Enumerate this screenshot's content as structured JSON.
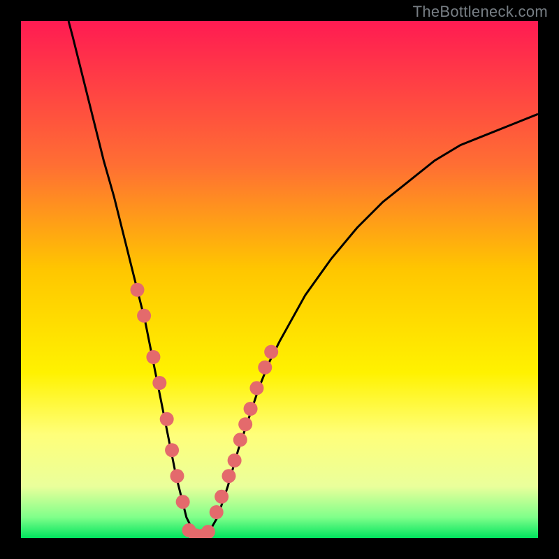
{
  "watermark": "TheBottleneck.com",
  "chart_data": {
    "type": "line",
    "title": "",
    "xlabel": "",
    "ylabel": "",
    "xlim": [
      0,
      100
    ],
    "ylim": [
      0,
      100
    ],
    "grid": false,
    "background_gradient": {
      "stops": [
        {
          "offset": 0,
          "color": "#ff1b52"
        },
        {
          "offset": 28,
          "color": "#ff6f33"
        },
        {
          "offset": 48,
          "color": "#ffc600"
        },
        {
          "offset": 68,
          "color": "#fff200"
        },
        {
          "offset": 80,
          "color": "#ffff7a"
        },
        {
          "offset": 90,
          "color": "#eaff9b"
        },
        {
          "offset": 96,
          "color": "#7fff8a"
        },
        {
          "offset": 100,
          "color": "#00e35e"
        }
      ]
    },
    "series": [
      {
        "name": "curve",
        "stroke": "#000000",
        "x": [
          9.2,
          10,
          12,
          14,
          16,
          18,
          20,
          22,
          24,
          25,
          26,
          27,
          28,
          29,
          30,
          31,
          32,
          33,
          34,
          35,
          36,
          38,
          40,
          42,
          44,
          46,
          48,
          50,
          55,
          60,
          65,
          70,
          75,
          80,
          85,
          90,
          95,
          100
        ],
        "y": [
          100,
          97,
          89,
          81,
          73,
          66,
          58,
          50,
          42,
          37,
          32,
          27,
          22,
          17,
          12,
          8,
          4,
          2,
          0.3,
          0,
          0.5,
          4,
          10,
          17,
          23,
          29,
          34,
          38,
          47,
          54,
          60,
          65,
          69,
          73,
          76,
          78,
          80,
          82
        ]
      },
      {
        "name": "scatter-left",
        "stroke": "none",
        "fill": "#e46a6c",
        "marker_r": 10,
        "x": [
          22.5,
          23.8,
          25.6,
          26.8,
          28.2,
          29.2,
          30.2,
          31.3
        ],
        "y": [
          48,
          43,
          35,
          30,
          23,
          17,
          12,
          7
        ]
      },
      {
        "name": "scatter-bottom",
        "stroke": "none",
        "fill": "#e46a6c",
        "marker_r": 10,
        "x": [
          32.5,
          33.8,
          35.0,
          36.2
        ],
        "y": [
          1.5,
          0.5,
          0.4,
          1.2
        ]
      },
      {
        "name": "scatter-right",
        "stroke": "none",
        "fill": "#e46a6c",
        "marker_r": 10,
        "x": [
          37.8,
          38.8,
          40.2,
          41.3,
          42.4,
          43.4,
          44.4,
          45.6,
          47.2,
          48.4
        ],
        "y": [
          5,
          8,
          12,
          15,
          19,
          22,
          25,
          29,
          33,
          36
        ]
      }
    ]
  }
}
